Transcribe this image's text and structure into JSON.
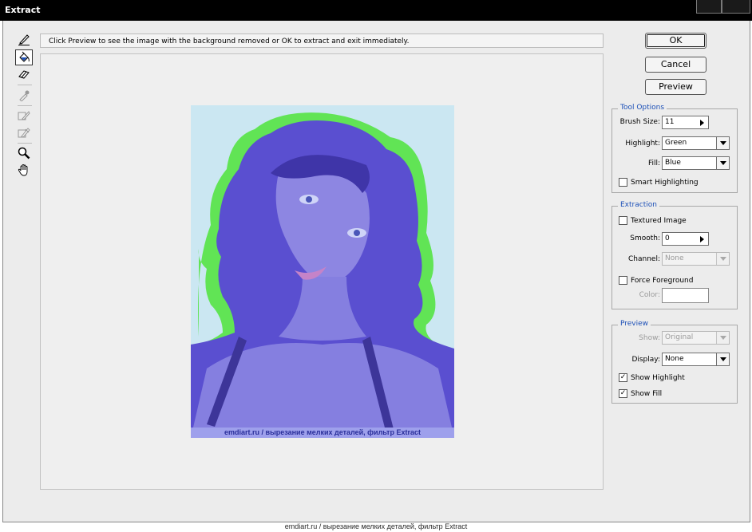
{
  "window": {
    "title": "Extract"
  },
  "hint": "Click Preview to see the image with the background removed or OK to extract and exit immediately.",
  "tools": [
    {
      "icon": "edge-highlighter-icon",
      "active": false,
      "disabled": false
    },
    {
      "icon": "fill-bucket-icon",
      "active": true,
      "disabled": false
    },
    {
      "icon": "eraser-icon",
      "active": false,
      "disabled": false
    },
    {
      "icon": "eyedropper-icon",
      "active": false,
      "disabled": true
    },
    {
      "icon": "cleanup-tool-icon",
      "active": false,
      "disabled": true
    },
    {
      "icon": "edge-touchup-icon",
      "active": false,
      "disabled": true
    },
    {
      "icon": "zoom-icon",
      "active": false,
      "disabled": false
    },
    {
      "icon": "hand-icon",
      "active": false,
      "disabled": false
    }
  ],
  "buttons": {
    "ok": "OK",
    "cancel": "Cancel",
    "preview": "Preview"
  },
  "tool_options": {
    "title": "Tool Options",
    "brush_size_label": "Brush Size:",
    "brush_size_value": "11",
    "highlight_label": "Highlight:",
    "highlight_value": "Green",
    "fill_label": "Fill:",
    "fill_value": "Blue",
    "smart_highlighting_label": "Smart Highlighting",
    "smart_highlighting_checked": false
  },
  "extraction": {
    "title": "Extraction",
    "textured_image_label": "Textured Image",
    "textured_image_checked": false,
    "smooth_label": "Smooth:",
    "smooth_value": "0",
    "channel_label": "Channel:",
    "channel_value": "None",
    "force_foreground_label": "Force Foreground",
    "force_foreground_checked": false,
    "color_label": "Color:"
  },
  "preview": {
    "title": "Preview",
    "show_label": "Show:",
    "show_value": "Original",
    "display_label": "Display:",
    "display_value": "None",
    "show_highlight_label": "Show Highlight",
    "show_highlight_checked": true,
    "show_fill_label": "Show Fill",
    "show_fill_checked": true
  },
  "image_caption": "emdiart.ru  /  вырезание мелких деталей, фильтр Extract",
  "footer_caption": "emdiart.ru  /  вырезание мелких деталей, фильтр Extract",
  "colors": {
    "highlight": "#3fd42c",
    "fill": "#5a4fd0",
    "background": "#cbe7f2"
  }
}
